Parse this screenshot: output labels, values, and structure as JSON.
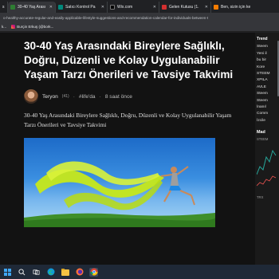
{
  "browser": {
    "tabs": [
      {
        "label": "s",
        "color": "#c2185b"
      },
      {
        "label": "30-40 Yaş Arası",
        "color": "#2e7d32",
        "active": true
      },
      {
        "label": "Satıcı Kontrol Pa",
        "color": "#00897b"
      },
      {
        "label": "Wix.com",
        "color": "#000000"
      },
      {
        "label": "Gelen Kutusu (1.",
        "color": "#d32f2f"
      },
      {
        "label": "Ben, sizin için ke",
        "color": "#f57c00"
      }
    ],
    "url": "o-healthy-accurate-regular-and-easily-applicable-lifestyle-suggestions-and-recommendation-calendar-for-individuals-between-t",
    "bookmarks": [
      {
        "label": "k...",
        "color": "#1976d2"
      },
      {
        "label": "Burçin Erkuş (@bork...",
        "color": "#e91e63"
      }
    ]
  },
  "article": {
    "title": "30-40 Yaş Arasındaki Bireylere Sağlıklı, Doğru, Düzenli ve Kolay Uygulanabilir Yaşam Tarzı Önerileri ve Tavsiye Takvimi",
    "author": "Teryon",
    "author_count": "(41)",
    "dot": "·",
    "tag": "#life'da",
    "time": "8 saat önce",
    "lead": "30-40 Yaş Arasındaki Bireylere Sağlıklı, Doğru, Düzenli ve Kolay Uygulanabilir Yaşam Tarzı Önerileri ve Tavsiye Takvimi"
  },
  "sidebar": {
    "heading": "Trend",
    "items": [
      "Steem",
      "Yeni il",
      "bu bir",
      "Kore",
      "STEEM",
      "XPILA",
      "AVLE",
      "Steem",
      "Steem",
      "İnanıl",
      "Comm",
      "İzcile"
    ],
    "market_title": "Mad",
    "axis": [
      "STEEM",
      "TRX"
    ]
  },
  "taskbar": {
    "icons": [
      "windows-start-icon",
      "search-icon",
      "task-view-icon",
      "edge-icon",
      "explorer-icon",
      "firefox-icon",
      "chrome-icon"
    ]
  }
}
